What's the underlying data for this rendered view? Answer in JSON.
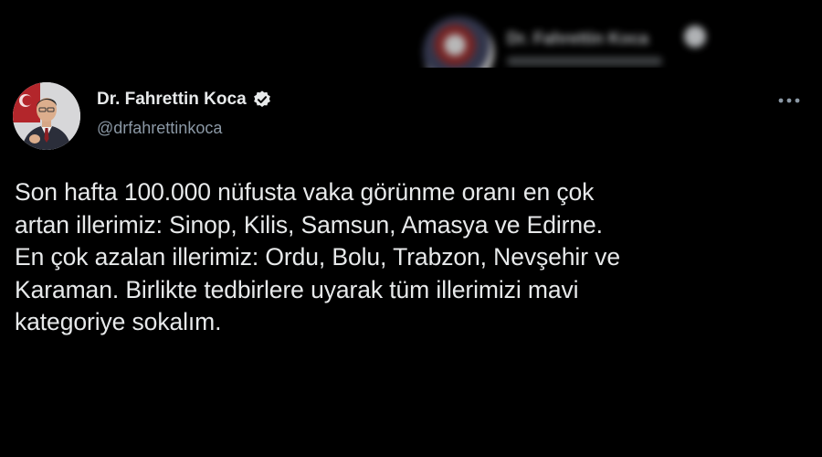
{
  "background_tweet": {
    "display_name": "Dr. Fahrettin Koca",
    "verified_icon": "verified-badge-icon"
  },
  "tweet": {
    "author": {
      "display_name": "Dr. Fahrettin Koca",
      "handle": "@drfahrettinkoca",
      "avatar_icon": "profile-photo",
      "verified_icon": "verified-badge-icon"
    },
    "more_icon": "more-options-icon",
    "text": "Son hafta 100.000 nüfusta vaka görünme oranı en çok\nartan illerimiz: Sinop, Kilis, Samsun, Amasya ve Edirne.\nEn çok azalan illerimiz: Ordu, Bolu, Trabzon, Nevşehir ve\nKaraman. Birlikte tedbirlere uyarak tüm illerimizi mavi\nkategoriye sokalım."
  },
  "colors": {
    "background": "#000000",
    "text_primary": "#e7e9ea",
    "text_secondary": "#8b98a5"
  }
}
